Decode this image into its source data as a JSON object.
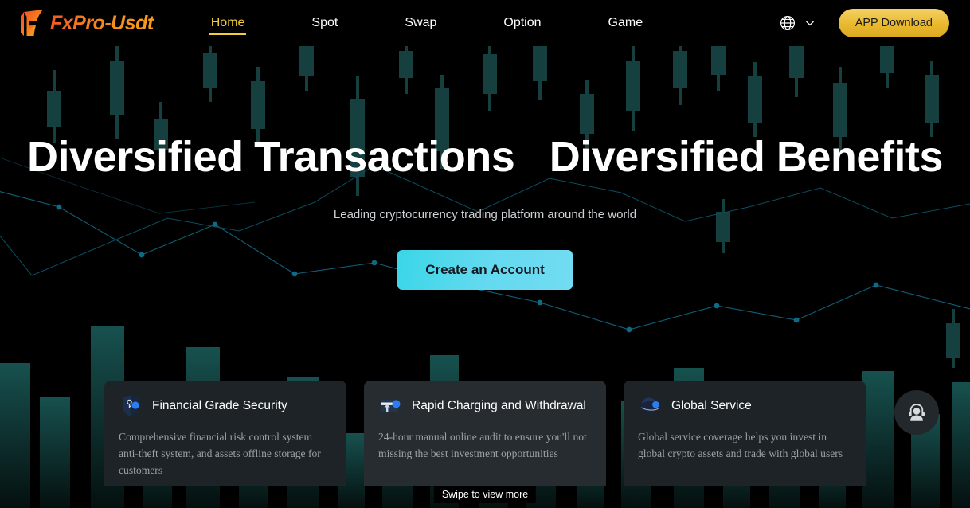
{
  "brand": {
    "logo_text": "FxPro-Usdt",
    "logo_mark_icon": "fxpro-f-logo-icon",
    "gradient_start": "#f05a22",
    "gradient_end": "#f9a01b"
  },
  "header": {
    "nav": [
      {
        "label": "Home",
        "active": true
      },
      {
        "label": "Spot",
        "active": false
      },
      {
        "label": "Swap",
        "active": false
      },
      {
        "label": "Option",
        "active": false
      },
      {
        "label": "Game",
        "active": false
      }
    ],
    "active_color": "#f2cd35",
    "language_icon": "globe-icon",
    "language_chevron_icon": "chevron-down-icon",
    "app_download_label": "APP Download",
    "app_download_color": "#e8b92e"
  },
  "hero": {
    "title": "Diversified Transactions   Diversified Benefits",
    "subtitle": "Leading cryptocurrency trading platform around the world",
    "cta_label": "Create an Account",
    "cta_color": "#4fd8ec"
  },
  "cards": [
    {
      "icon": "shield-lock-icon",
      "title": "Financial Grade Security",
      "body": "Comprehensive financial risk control system anti-theft system, and assets offline storage for customers"
    },
    {
      "icon": "rapid-transfer-icon",
      "title": "Rapid Charging and Withdrawal",
      "body": "24-hour manual online audit to ensure you'll not missing the best investment opportunities"
    },
    {
      "icon": "planet-globe-icon",
      "title": "Global Service",
      "body": "Global service coverage helps you invest in global crypto assets and trade with global users"
    }
  ],
  "swipe_hint": "Swipe to view more",
  "support": {
    "icon": "customer-support-headset-icon"
  },
  "background": {
    "candle_color": "#15403f",
    "line_color": "#0f5f78",
    "bar_color": "#0d2b2c"
  }
}
